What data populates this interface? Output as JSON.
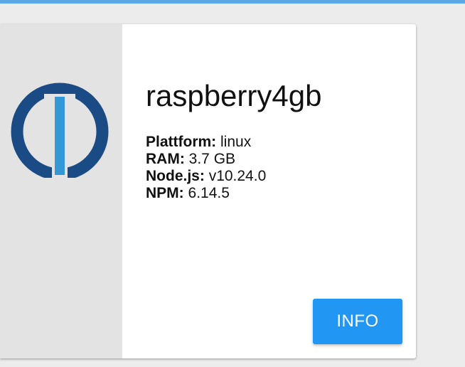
{
  "card": {
    "title": "raspberry4gb",
    "rows": [
      {
        "label": "Plattform:",
        "value": "linux"
      },
      {
        "label": "RAM:",
        "value": "3.7 GB"
      },
      {
        "label": "Node.js:",
        "value": "v10.24.0"
      },
      {
        "label": "NPM:",
        "value": "6.14.5"
      }
    ],
    "button_label": "INFO",
    "logo_icon": "iobroker-logo-icon"
  },
  "colors": {
    "top_bar": "#5aa9e6",
    "media_background": "#e3e3e3",
    "logo_ring": "#1a4b84",
    "logo_bar": "#3399d6",
    "button": "#2196f3"
  }
}
